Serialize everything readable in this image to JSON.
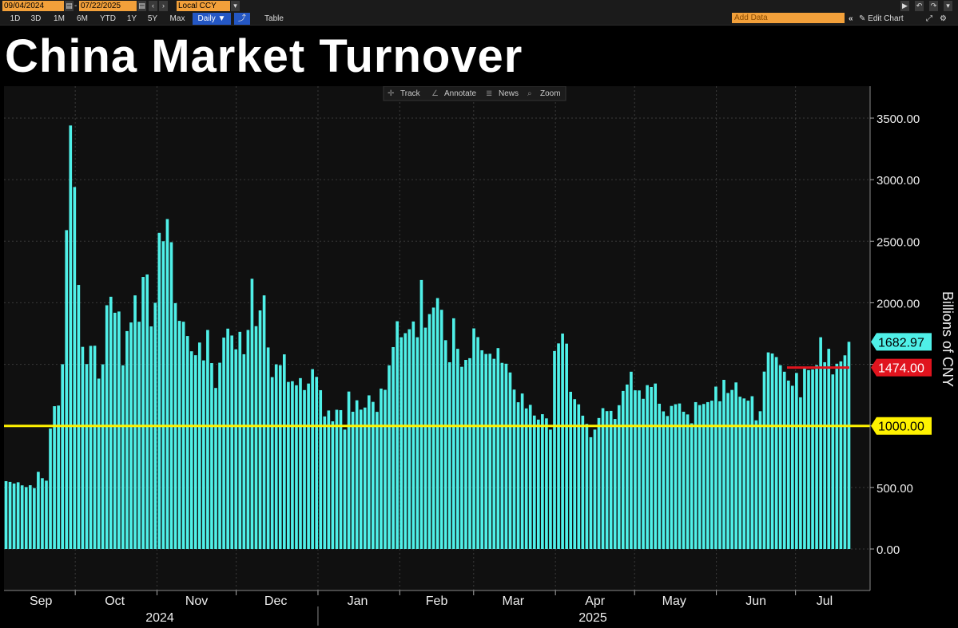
{
  "toolbar": {
    "start_date": "09/04/2024",
    "end_date": "07/22/2025",
    "currency": "Local CCY",
    "ranges": [
      "1D",
      "3D",
      "1M",
      "6M",
      "YTD",
      "1Y",
      "5Y",
      "Max"
    ],
    "period": "Daily",
    "table_label": "Table",
    "add_data_placeholder": "Add Data",
    "edit_chart_label": "Edit Chart"
  },
  "chart_tools": {
    "track": "Track",
    "annotate": "Annotate",
    "news": "News",
    "zoom": "Zoom"
  },
  "colors": {
    "bars": "#4ff0e8",
    "last_value": "#4ff0e8",
    "average_line": "#e0141e",
    "threshold_line": "#fff200",
    "background": "#101010"
  },
  "chart_data": {
    "type": "bar",
    "title": "China Market Turnover",
    "ylabel": "Billions of CNY",
    "ylim": [
      -330,
      3750
    ],
    "yticks": [
      "3500.00",
      "3000.00",
      "2500.00",
      "2000.00",
      "1500.00",
      "1000.00",
      "500.00",
      "0.00"
    ],
    "x_start": "2024-09-04",
    "x_end": "2025-07-22",
    "month_labels": [
      "Sep",
      "Oct",
      "Nov",
      "Dec",
      "Jan",
      "Feb",
      "Mar",
      "Apr",
      "May",
      "Jun",
      "Jul"
    ],
    "year_labels": [
      "2024",
      "2025"
    ],
    "values": [
      551,
      545,
      532,
      542,
      517,
      503,
      518,
      495,
      627,
      575,
      555,
      979,
      1160,
      1165,
      1501,
      2590,
      3440,
      2940,
      2145,
      1642,
      1502,
      1650,
      1651,
      1384,
      1500,
      1980,
      2049,
      1919,
      1929,
      1492,
      1770,
      1840,
      2060,
      1846,
      2210,
      2230,
      1808,
      2000,
      2568,
      2500,
      2680,
      2492,
      1997,
      1853,
      1846,
      1730,
      1606,
      1574,
      1677,
      1532,
      1779,
      1510,
      1308,
      1513,
      1717,
      1790,
      1734,
      1622,
      1764,
      1582,
      1779,
      2195,
      1810,
      1938,
      2060,
      1637,
      1396,
      1500,
      1493,
      1581,
      1357,
      1363,
      1330,
      1388,
      1291,
      1344,
      1461,
      1398,
      1290,
      1077,
      1125,
      1037,
      1131,
      1128,
      970,
      1279,
      1115,
      1208,
      1132,
      1149,
      1248,
      1195,
      1114,
      1303,
      1293,
      1492,
      1640,
      1850,
      1720,
      1753,
      1785,
      1848,
      1720,
      2185,
      1798,
      1908,
      1961,
      2038,
      1943,
      1696,
      1517,
      1874,
      1626,
      1480,
      1536,
      1550,
      1792,
      1721,
      1614,
      1584,
      1586,
      1545,
      1632,
      1512,
      1505,
      1434,
      1295,
      1192,
      1263,
      1142,
      1171,
      1084,
      1051,
      1095,
      1061,
      970,
      1608,
      1670,
      1750,
      1668,
      1277,
      1217,
      1175,
      1083,
      1016,
      908,
      970,
      1064,
      1144,
      1120,
      1122,
      1056,
      1168,
      1284,
      1336,
      1440,
      1289,
      1288,
      1220,
      1331,
      1316,
      1344,
      1180,
      1118,
      1080,
      1162,
      1176,
      1182,
      1115,
      1093,
      1021,
      1193,
      1169,
      1178,
      1193,
      1205,
      1319,
      1200,
      1374,
      1267,
      1292,
      1353,
      1237,
      1223,
      1205,
      1241,
      1045,
      1119,
      1441,
      1597,
      1588,
      1559,
      1493,
      1440,
      1368,
      1326,
      1430,
      1232,
      1474,
      1453,
      1459,
      1493,
      1720,
      1517,
      1626,
      1418,
      1505,
      1524,
      1573,
      1683
    ],
    "last_value_label": "1682.97",
    "average": {
      "value": 1474,
      "label": "1474.00"
    },
    "threshold": {
      "value": 1000,
      "label": "1000.00"
    },
    "grid": true
  }
}
